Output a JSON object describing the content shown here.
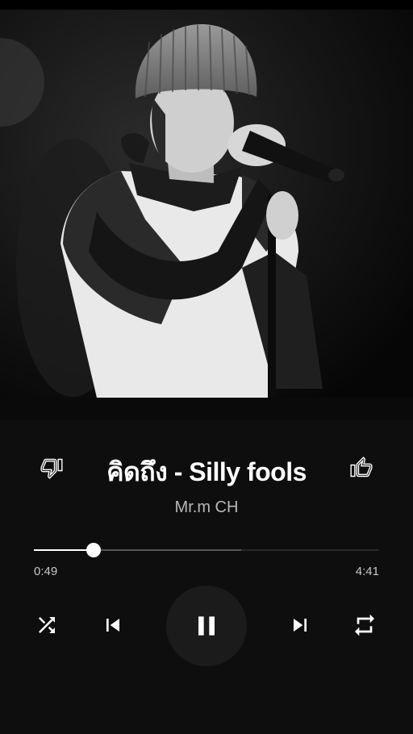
{
  "track": {
    "title": "คิดถึง - Silly fools",
    "artist": "Mr.m CH"
  },
  "playback": {
    "elapsed": "0:49",
    "duration": "4:41",
    "progress_fraction": 0.174,
    "buffered_fraction": 0.6
  },
  "icons": {
    "dislike": "thumbs-down-icon",
    "like": "thumbs-up-icon",
    "shuffle": "shuffle-icon",
    "previous": "skip-previous-icon",
    "play_pause": "pause-icon",
    "next": "skip-next-icon",
    "repeat": "repeat-icon"
  },
  "colors": {
    "background": "#0e0e0e",
    "accent": "#ffffff",
    "secondary_text": "#b8b8b8",
    "play_button_bg": "#1b1b1b"
  }
}
